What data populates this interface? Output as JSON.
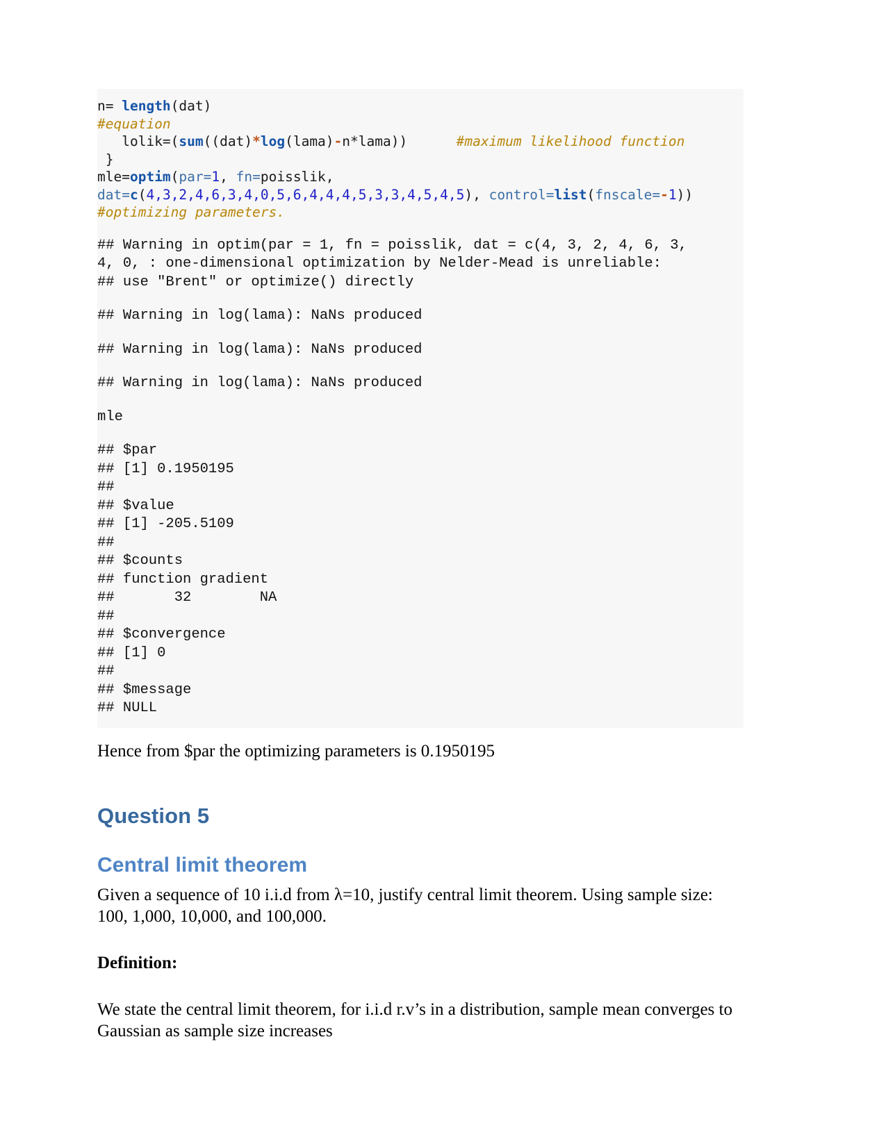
{
  "document": {
    "type": "r-markdown-knitted-report",
    "page_background": "#ffffff",
    "code_block_background": "#f7f7f7"
  },
  "colors": {
    "keyword": "#1754a8",
    "number": "#2020c8",
    "argument": "#3b6ea5",
    "comment": "#b8860b",
    "operator": "#c05621",
    "heading_question": "#38699e",
    "heading_section": "#4f84c4",
    "body_text": "#000000"
  },
  "code_block": {
    "source_lines": [
      "n= length(dat)",
      " #equation",
      "   lolik=(sum((dat)*log(lama)-n*lama))      #maximum likelihood function",
      " }",
      "mle=optim(par=1, fn=poisslik, dat=c(4,3,2,4,6,3,4,0,5,6,4,4,4,5,3,3,4,5,4,5), control=list(fnscale=-1))           #optimizing parameters."
    ],
    "tokens": {
      "line1": {
        "plain_a": "n= ",
        "kw": "length",
        "plain_b": "(dat)"
      },
      "line2": {
        "comment": "#equation"
      },
      "line3": {
        "indent": "   ",
        "plain_a": "lolik=(",
        "kw1": "sum",
        "plain_b": "((dat)",
        "op1": "*",
        "kw2": "log",
        "plain_c": "(lama)",
        "op2": "-",
        "plain_d": "n*lama))",
        "spacer": "      ",
        "comment": "#maximum likelihood function"
      },
      "line4": {
        "plain": " }"
      },
      "line5": {
        "plain_a": "mle=",
        "kw1": "optim",
        "plain_b": "(",
        "arg1": "par=",
        "num1": "1",
        "plain_c": ", ",
        "arg2": "fn=",
        "plain_d": "poisslik,",
        "newline_break": true,
        "arg3": "dat=",
        "kw2": "c",
        "plain_e": "(",
        "numbers": "4,3,2,4,6,3,4,0,5,6,4,4,4,5,3,3,4,5,4,5",
        "plain_f": "), ",
        "arg4": "control=",
        "kw3": "list",
        "plain_g": "(",
        "arg5": "fnscale=",
        "op": "-",
        "num2": "1",
        "plain_h": "))",
        "spacer": "           ",
        "comment": "#optimizing parameters."
      }
    },
    "outputs": [
      {
        "name": "warning-nelder-mead",
        "lines": [
          "## Warning in optim(par = 1, fn = poisslik, dat = c(4, 3, 2, 4, 6, 3,",
          "4, 0, : one-dimensional optimization by Nelder-Mead is unreliable:",
          "## use \"Brent\" or optimize() directly"
        ]
      },
      {
        "name": "warning-nans-1",
        "lines": [
          "## Warning in log(lama): NaNs produced"
        ]
      },
      {
        "name": "warning-nans-2",
        "lines": [
          "## Warning in log(lama): NaNs produced"
        ]
      },
      {
        "name": "warning-nans-3",
        "lines": [
          "## Warning in log(lama): NaNs produced"
        ]
      }
    ],
    "mle_call": "mle",
    "mle_result_lines": [
      "## $par",
      "## [1] 0.1950195",
      "##",
      "## $value",
      "## [1] -205.5109",
      "##",
      "## $counts",
      "## function gradient",
      "##       32        NA",
      "##",
      "## $convergence",
      "## [1] 0",
      "##",
      "## $message",
      "## NULL"
    ],
    "result_values": {
      "par": "0.1950195",
      "value": "-205.5109",
      "counts_function": "32",
      "counts_gradient": "NA",
      "convergence": "0",
      "message": "NULL"
    }
  },
  "prose": {
    "hence_line": "Hence from $par the optimizing parameters is 0.1950195",
    "question_heading": "Question 5",
    "section_heading": "Central limit theorem",
    "intro_paragraph": "Given a sequence of 10 i.i.d from λ=10, justify central limit theorem. Using sample size: 100, 1,000, 10,000, and 100,000.",
    "definition_label": "Definition:",
    "definition_paragraph": "We state the central limit theorem, for i.i.d r.v’s in a distribution, sample mean converges to Gaussian as sample size increases"
  }
}
